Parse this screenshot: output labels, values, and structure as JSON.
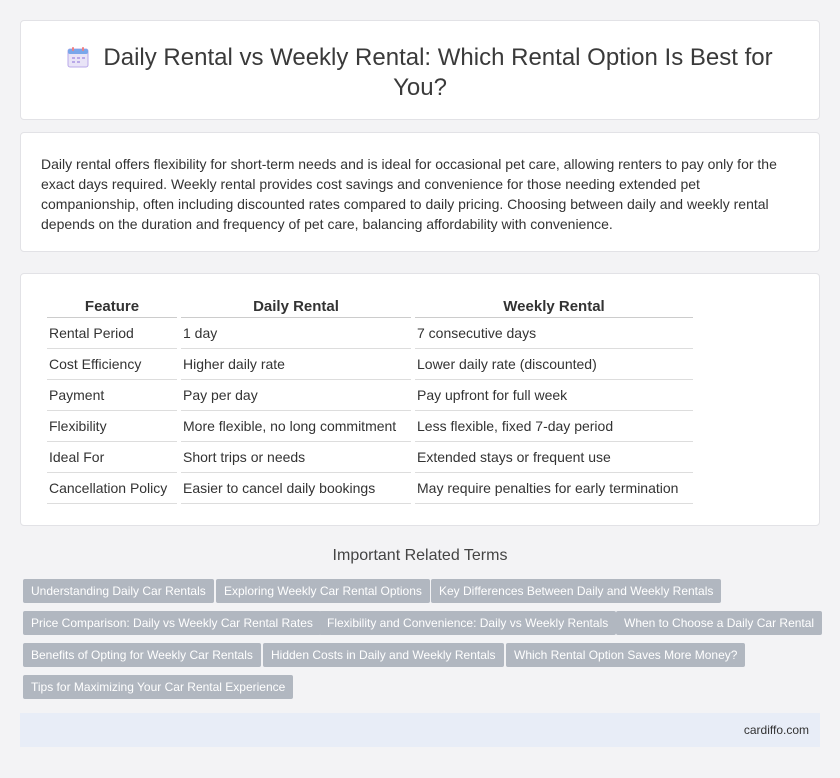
{
  "header": {
    "title": "Daily Rental vs Weekly Rental: Which Rental Option Is Best for You?",
    "icon": "calendar-icon"
  },
  "intro": {
    "text": "Daily rental offers flexibility for short-term needs and is ideal for occasional pet care, allowing renters to pay only for the exact days required. Weekly rental provides cost savings and convenience for those needing extended pet companionship, often including discounted rates compared to daily pricing. Choosing between daily and weekly rental depends on the duration and frequency of pet care, balancing affordability with convenience."
  },
  "table": {
    "headers": [
      "Feature",
      "Daily Rental",
      "Weekly Rental"
    ],
    "rows": [
      [
        "Rental Period",
        "1 day",
        "7 consecutive days"
      ],
      [
        "Cost Efficiency",
        "Higher daily rate",
        "Lower daily rate (discounted)"
      ],
      [
        "Payment",
        "Pay per day",
        "Pay upfront for full week"
      ],
      [
        "Flexibility",
        "More flexible, no long commitment",
        "Less flexible, fixed 7-day period"
      ],
      [
        "Ideal For",
        "Short trips or needs",
        "Extended stays or frequent use"
      ],
      [
        "Cancellation Policy",
        "Easier to cancel daily bookings",
        "May require penalties for early termination"
      ]
    ]
  },
  "related": {
    "heading": "Important Related Terms",
    "tags": [
      "Understanding Daily Car Rentals",
      "Exploring Weekly Car Rental Options",
      "Key Differences Between Daily and Weekly Rentals",
      "Price Comparison: Daily vs Weekly Car Rental Rates",
      "Flexibility and Convenience: Daily vs Weekly Rentals",
      "When to Choose a Daily Car Rental",
      "Benefits of Opting for Weekly Car Rentals",
      "Hidden Costs in Daily and Weekly Rentals",
      "Which Rental Option Saves More Money?",
      "Tips for Maximizing Your Car Rental Experience"
    ]
  },
  "footer": {
    "site": "cardiffo.com"
  },
  "colors": {
    "tag_bg": "#b1b7c0",
    "footer_bg": "#e8edf7",
    "page_bg": "#f3f3f5"
  }
}
